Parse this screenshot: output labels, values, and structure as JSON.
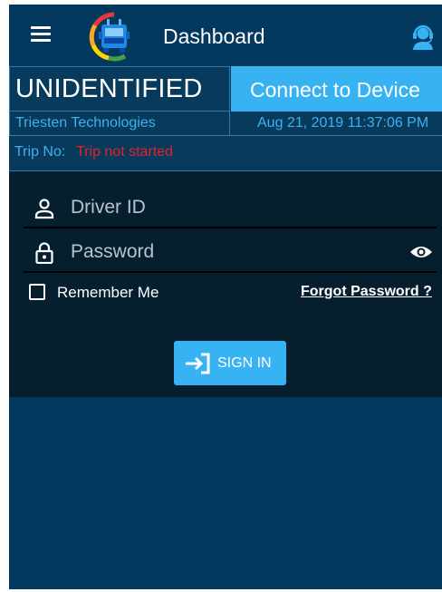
{
  "header": {
    "title": "Dashboard",
    "menu_icon": "hamburger-menu-icon",
    "logo_icon": "truck-gauge-logo-icon",
    "support_icon": "support-agent-icon"
  },
  "status": {
    "driver_status": "UNIDENTIFIED",
    "connect_label": "Connect to Device",
    "company": "Triesten Technologies",
    "datetime": "Aug 21, 2019 11:37:06 PM",
    "trip_label": "Trip No:",
    "trip_value": "Trip not started"
  },
  "login": {
    "driver_id_placeholder": "Driver ID",
    "password_placeholder": "Password",
    "remember_label": "Remember Me",
    "forgot_label": "Forgot Password ?",
    "signin_label": "SIGN IN",
    "user_icon": "person-icon",
    "lock_icon": "lock-icon",
    "eye_icon": "eye-icon",
    "signin_icon": "login-arrow-icon"
  },
  "colors": {
    "background": "#04395f",
    "panel": "#061f2f",
    "accent": "#37b2f2",
    "link_text": "#3fb0f0",
    "alert": "#e0232b"
  }
}
